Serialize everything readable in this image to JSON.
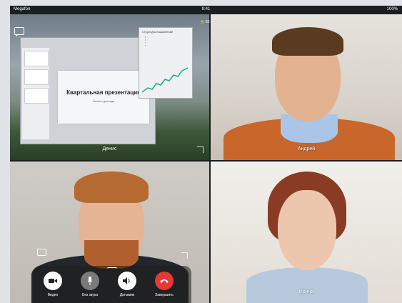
{
  "status_bar": {
    "carrier": "Megafon",
    "time": "9:41",
    "battery": "100%"
  },
  "call": {
    "timer": "02:01"
  },
  "shared_screen": {
    "slide_title": "Квартальная презентация",
    "slide_subtitle": "Начало доклада",
    "chart_title": "Структура показателей"
  },
  "participants": [
    {
      "name": "Денис"
    },
    {
      "name": "Андрей"
    },
    {
      "name": ""
    },
    {
      "name": "Ирина"
    }
  ],
  "controls": {
    "video_label": "Видео",
    "mute_label": "Без звука",
    "speaker_label": "Динамик",
    "end_label": "Завершить"
  },
  "colors": {
    "end_call": "#e53935",
    "video_button": "#ffffff",
    "muted_button": "#7a7a7a"
  }
}
